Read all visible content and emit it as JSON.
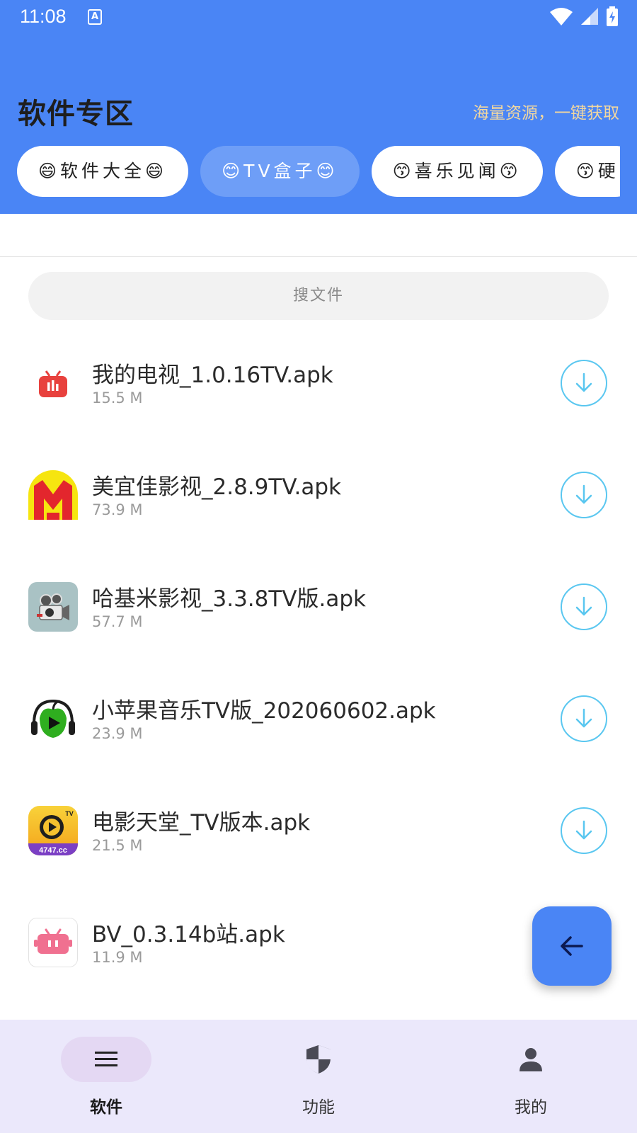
{
  "status": {
    "time": "11:08",
    "notification_icon": "A"
  },
  "header": {
    "title": "软件专区",
    "subtitle": "海量资源，一键获取",
    "chips": [
      "😄软件大全😄",
      "😊TV盒子😊",
      "😙喜乐见闻😙",
      "😙硬"
    ]
  },
  "search": {
    "placeholder": "搜文件"
  },
  "files": [
    {
      "name": "我的电视_1.0.16TV.apk",
      "size": "15.5 M",
      "icon": "tv-robot-icon"
    },
    {
      "name": "美宜佳影视_2.8.9TV.apk",
      "size": "73.9 M",
      "icon": "yellow-m-logo-icon"
    },
    {
      "name": "哈基米影视_3.3.8TV版.apk",
      "size": "57.7 M",
      "icon": "film-camera-icon"
    },
    {
      "name": "小苹果音乐TV版_202060602.apk",
      "size": "23.9 M",
      "icon": "green-apple-headphones-icon"
    },
    {
      "name": "电影天堂_TV版本.apk",
      "size": "21.5 M",
      "icon": "play-4747-icon"
    },
    {
      "name": "BV_0.3.14b站.apk",
      "size": "11.9 M",
      "icon": "bilibili-tv-icon"
    }
  ],
  "tv_badge": "TV",
  "brand_badge": "4747.cc",
  "nav": [
    {
      "label": "软件",
      "icon": "menu-icon"
    },
    {
      "label": "功能",
      "icon": "shield-icon"
    },
    {
      "label": "我的",
      "icon": "person-icon"
    }
  ],
  "colors": {
    "primary": "#4a85f5",
    "download_ring": "#5ac7f0",
    "nav_bg": "#ebe8fb"
  }
}
